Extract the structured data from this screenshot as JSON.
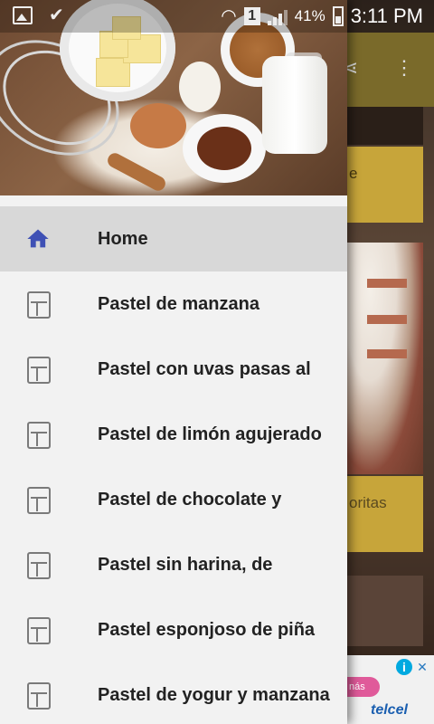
{
  "status_bar": {
    "battery_percent": "41%",
    "time": "3:11 PM",
    "sim_slot": "1"
  },
  "background_app": {
    "card1_text": "e",
    "card2_text": "oritas",
    "ad_pill_text": "nás",
    "ad_brand": "telcel"
  },
  "drawer": {
    "items": [
      {
        "label": "Home",
        "icon": "home-icon",
        "active": true
      },
      {
        "label": "Pastel de manzana",
        "icon": "recipe-icon"
      },
      {
        "label": "Pastel con uvas pasas al",
        "icon": "recipe-icon"
      },
      {
        "label": "Pastel de limón agujerado",
        "icon": "recipe-icon"
      },
      {
        "label": "Pastel de chocolate y",
        "icon": "recipe-icon"
      },
      {
        "label": "Pastel sin harina, de",
        "icon": "recipe-icon"
      },
      {
        "label": "Pastel esponjoso de piña",
        "icon": "recipe-icon"
      },
      {
        "label": "Pastel de yogur y manzana",
        "icon": "recipe-icon"
      }
    ]
  },
  "colors": {
    "accent": "#3f51b5",
    "drawer_bg": "#f2f2f2",
    "active_item_bg": "#d8d8d8",
    "toolbar": "#7a6a2a",
    "card": "#c7a53a"
  }
}
